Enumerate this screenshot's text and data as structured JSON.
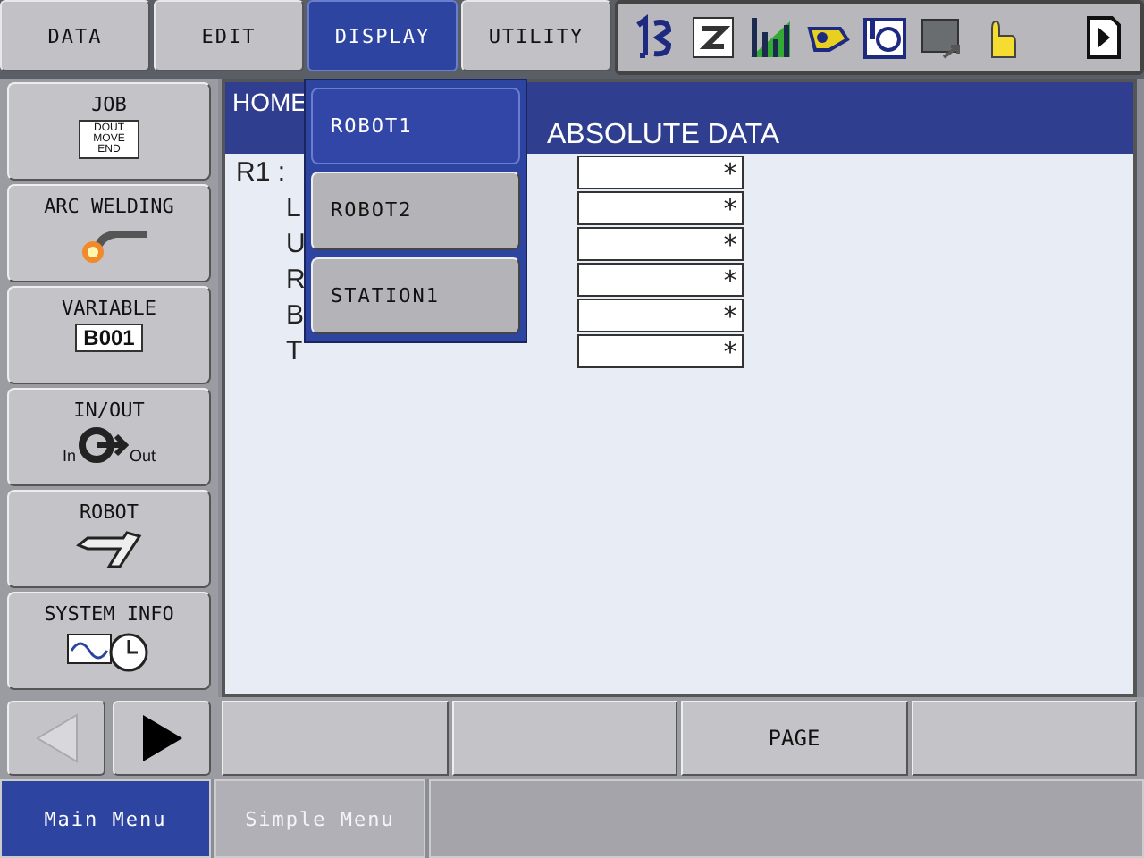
{
  "menu_bar": {
    "tabs": [
      {
        "label": "DATA",
        "selected": false
      },
      {
        "label": "EDIT",
        "selected": false
      },
      {
        "label": "DISPLAY",
        "selected": true
      },
      {
        "label": "UTILITY",
        "selected": false
      }
    ]
  },
  "dropdown": {
    "items": [
      {
        "label": "ROBOT1",
        "selected": true
      },
      {
        "label": "ROBOT2",
        "selected": false
      },
      {
        "label": "STATION1",
        "selected": false
      }
    ]
  },
  "sidebar": {
    "items": [
      {
        "label": "JOB",
        "kind": "job",
        "badge": "DOUT MOVE END"
      },
      {
        "label": "ARC WELDING",
        "kind": "weld"
      },
      {
        "label": "VARIABLE",
        "kind": "variable",
        "badge": "B001"
      },
      {
        "label": "IN/OUT",
        "kind": "io",
        "badge_left": "In",
        "badge_right": "Out"
      },
      {
        "label": "ROBOT",
        "kind": "robot"
      },
      {
        "label": "SYSTEM INFO",
        "kind": "sysinfo"
      }
    ]
  },
  "content": {
    "title": "HOME",
    "column_heading": "ABSOLUTE DATA",
    "rows": [
      {
        "label": "R1 :",
        "kind": "group",
        "value": "*"
      },
      {
        "label": "L",
        "kind": "axis",
        "value": "*"
      },
      {
        "label": "U",
        "kind": "axis",
        "value": "*"
      },
      {
        "label": "R",
        "kind": "axis",
        "value": "*"
      },
      {
        "label": "B",
        "kind": "axis",
        "value": "*"
      },
      {
        "label": "T",
        "kind": "axis",
        "value": "*"
      }
    ]
  },
  "function_keys": [
    {
      "kind": "blank"
    },
    {
      "kind": "blank"
    },
    {
      "kind": "labeled",
      "label": "PAGE"
    },
    {
      "kind": "blank"
    }
  ],
  "bottom_tabs": [
    {
      "label": "Main Menu",
      "selected": true
    },
    {
      "label": "Simple Menu",
      "selected": false
    }
  ]
}
